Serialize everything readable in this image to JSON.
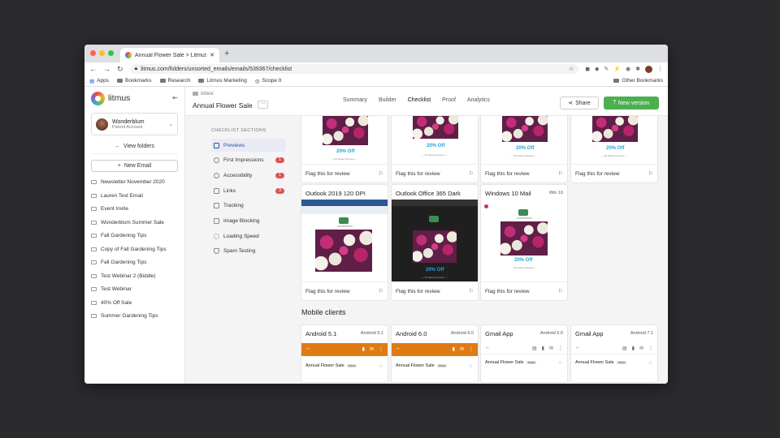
{
  "browser": {
    "tab_title": "Annual Flower Sale > Litmus",
    "url": "litmus.com/folders/unsorted_emails/emails/539367/checklist",
    "bookmarks": [
      "Apps",
      "Bookmarks",
      "Research",
      "Litmus Marketing",
      "Scope It"
    ],
    "other_bookmarks": "Other Bookmarks"
  },
  "sidebar": {
    "brand": "litmus",
    "account_name": "Wonderblum",
    "account_sub": "Parent Account",
    "view_folders": "View folders",
    "new_email": "New Email",
    "emails": [
      "Newsletter November 2020",
      "Lauren Test Email",
      "Event Invite",
      "Wonderblum Summer Sale",
      "Fall Gardening Tips",
      "Copy of Fall Gardening Tips",
      "Fall Gardening Tips",
      "Test Webinar 2 (Biddle)",
      "Test Webinar",
      "40% Off Sale",
      "Summer Gardening Tips"
    ]
  },
  "header": {
    "breadcrumb": "Inbox",
    "title": "Annual Flower Sale",
    "more": "···",
    "tabs": [
      "Summary",
      "Builder",
      "Checklist",
      "Proof",
      "Analytics"
    ],
    "active_tab": "Checklist",
    "share": "Share",
    "new_version": "New version"
  },
  "checklist": {
    "title": "CHECKLIST SECTIONS",
    "items": [
      {
        "label": "Previews",
        "badge": ""
      },
      {
        "label": "First Impressions",
        "badge": "1"
      },
      {
        "label": "Accessibility",
        "badge": "1"
      },
      {
        "label": "Links",
        "badge": "3"
      },
      {
        "label": "Tracking",
        "badge": ""
      },
      {
        "label": "Image Blocking",
        "badge": ""
      },
      {
        "label": "Loading Speed",
        "badge": ""
      },
      {
        "label": "Spam Testing",
        "badge": ""
      }
    ]
  },
  "previews": {
    "flag_label": "Flag this for review",
    "offer": "20% Off",
    "offer_sub": "— All Sweet Peonies —",
    "brand": "wonderblum",
    "desktop": [
      {
        "name": "Outlook 2019 120 DPI",
        "version": ""
      },
      {
        "name": "Outlook Office 365 Dark",
        "version": ""
      },
      {
        "name": "Windows 10 Mail",
        "version": "Win 10"
      }
    ],
    "mobile_title": "Mobile clients",
    "mobile": [
      {
        "name": "Android 5.1",
        "version": "Android 5.1"
      },
      {
        "name": "Android 6.0",
        "version": "Android 6.0"
      },
      {
        "name": "Gmail App",
        "version": "Android 6.0"
      },
      {
        "name": "Gmail App",
        "version": "Android 7.1"
      }
    ],
    "mobile_subject": "Annual Flower Sale",
    "mobile_tag": "Inbox"
  },
  "colors": {
    "accent_green": "#4caf50",
    "badge_red": "#e05353",
    "android_orange": "#e07b14",
    "active_blue": "#2c4fa8"
  }
}
